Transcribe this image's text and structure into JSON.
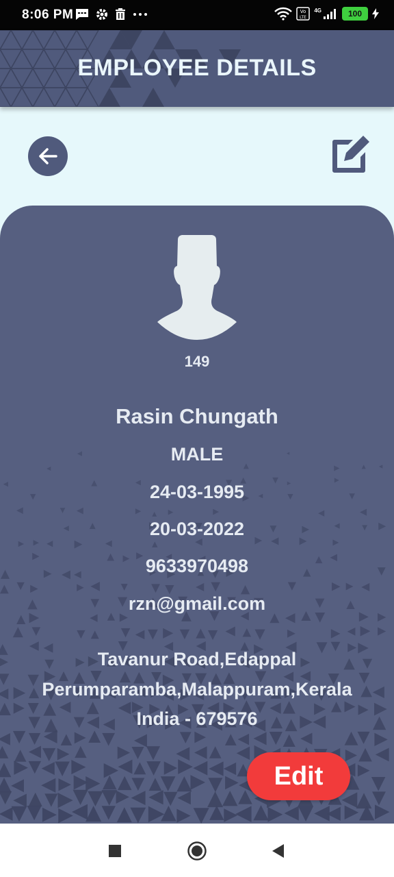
{
  "status_bar": {
    "time": "8:06 PM",
    "battery": "100",
    "network": "4G",
    "icons": [
      "message-icon",
      "gear-icon",
      "trash-icon",
      "more-icon",
      "wifi-icon",
      "volte-icon",
      "signal-icon",
      "battery-icon",
      "charging-icon"
    ]
  },
  "header": {
    "title": "EMPLOYEE DETAILS"
  },
  "actions": {
    "back_icon": "arrow-left-icon",
    "edit_icon": "edit-icon",
    "edit_label": "Edit"
  },
  "employee": {
    "id": "149",
    "name": "Rasin Chungath",
    "gender": "MALE",
    "dob": "24-03-1995",
    "join_date": "20-03-2022",
    "phone": "9633970498",
    "email": "rzn@gmail.com",
    "address_line1": "Tavanur Road,Edappal",
    "address_line2": "Perumparamba,Malappuram,Kerala",
    "address_line3": "India - 679576"
  },
  "nav_bar": {
    "buttons": [
      "recents-icon",
      "home-icon",
      "back-nav-icon"
    ]
  },
  "colors": {
    "primary": "#505a7c",
    "background": "#e6f8fb",
    "accent": "#f23b3b",
    "text_light": "#e6ebf2"
  }
}
